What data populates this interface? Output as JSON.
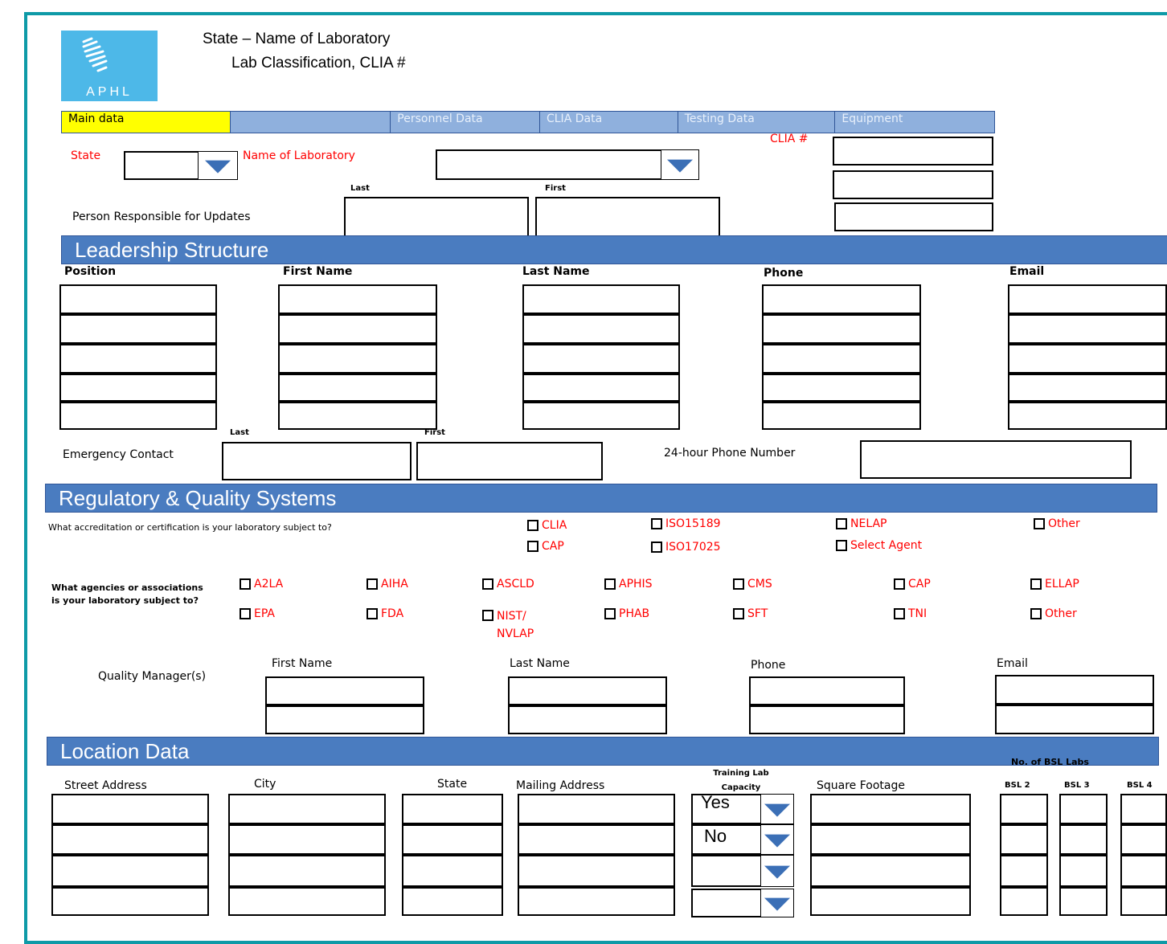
{
  "header": {
    "logo_text": "APHL",
    "title_line1": "State – Name of Laboratory",
    "title_line2": "Lab Classification,  CLIA #"
  },
  "tabs": [
    "Main data",
    "",
    "Personnel Data",
    "CLIA Data",
    "Testing Data",
    "Equipment"
  ],
  "main": {
    "state_label": "State",
    "lab_label": "Name of Laboratory",
    "clia_label": "CLIA #",
    "last_label": "Last",
    "first_label": "First",
    "person_label": "Person Responsible for Updates"
  },
  "leadership": {
    "title": "Leadership Structure",
    "headers": [
      "Position",
      "First Name",
      "Last Name",
      "Phone",
      "Email"
    ],
    "emergency_label": "Emergency Contact",
    "last_label": "Last",
    "first_label": "First",
    "phone24_label": "24-hour  Phone Number"
  },
  "regulatory": {
    "title": "Regulatory & Quality Systems",
    "accred_question": "What accreditation or certification  is your laboratory subject to?",
    "accred_options": [
      "CLIA",
      "CAP",
      "ISO15189",
      "ISO17025",
      "NELAP",
      "Select Agent",
      "Other"
    ],
    "agencies_question": "What agencies or associations is your laboratory subject to?",
    "agency_options": [
      "A2LA",
      "AIHA",
      "ASCLD",
      "APHIS",
      "CMS",
      "CAP",
      "ELLAP",
      "EPA",
      "FDA",
      "NIST/ NVLAP",
      "PHAB",
      "SFT",
      "TNI",
      "Other"
    ],
    "qm_label": "Quality Manager(s)",
    "qm_headers": [
      "First Name",
      "Last Name",
      "Phone",
      "Email"
    ]
  },
  "location": {
    "title": "Location Data",
    "headers": [
      "Street Address",
      "City",
      "State",
      "Mailing Address",
      "Training Lab Capacity",
      "Square Footage"
    ],
    "bsl_title": "No. of BSL Labs",
    "bsl_headers": [
      "BSL 2",
      "BSL 3",
      "BSL 4"
    ],
    "capacity_values": [
      "Yes",
      "No",
      "",
      ""
    ]
  }
}
